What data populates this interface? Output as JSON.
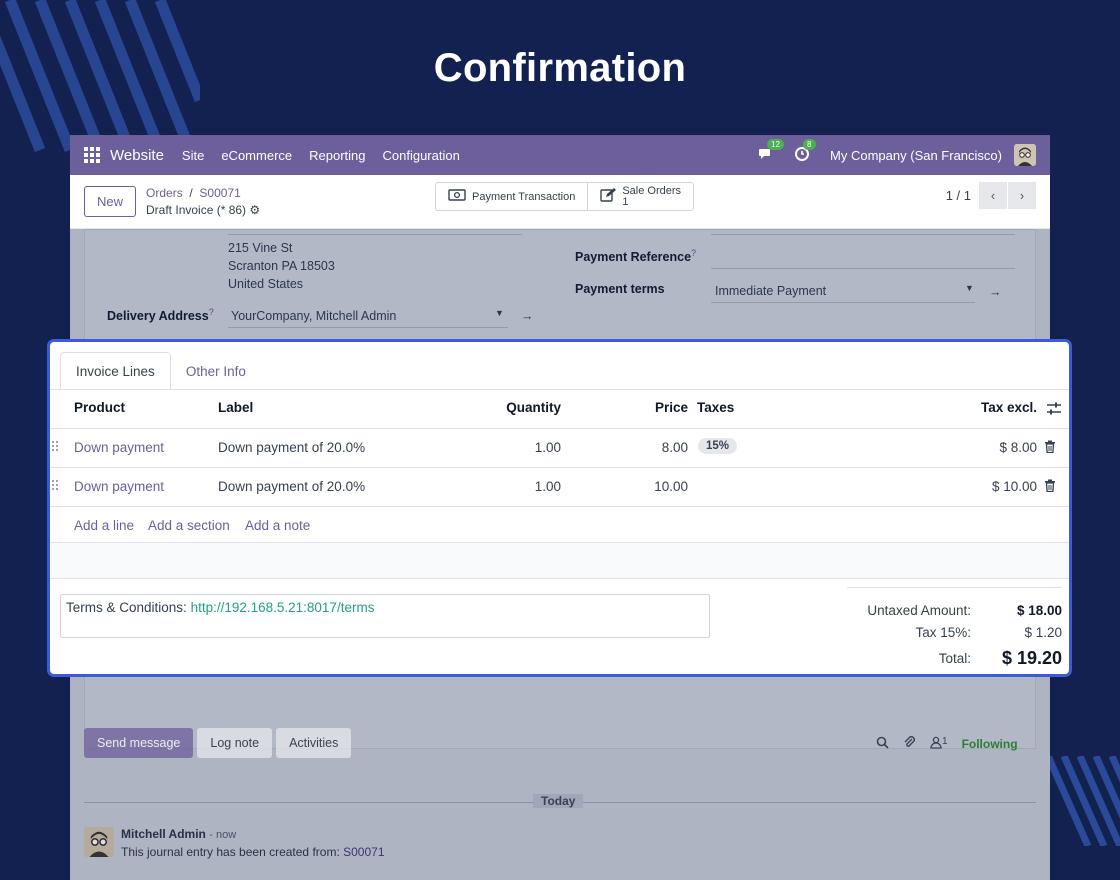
{
  "heading": "Confirmation",
  "navbar": {
    "brand": "Website",
    "menus": [
      "Site",
      "eCommerce",
      "Reporting",
      "Configuration"
    ],
    "messages_count": "12",
    "activities_count": "8",
    "company": "My Company (San Francisco)"
  },
  "control_panel": {
    "new_label": "New",
    "breadcrumb": [
      "Orders",
      "S00071"
    ],
    "record_title": "Draft Invoice (* 86)",
    "smart_buttons": {
      "payment_transaction": "Payment Transaction",
      "sale_orders_label": "Sale Orders",
      "sale_orders_count": "1"
    },
    "pager": "1 / 1"
  },
  "form": {
    "address_lines": [
      "215 Vine St",
      "Scranton PA 18503",
      "United States"
    ],
    "delivery_address_label": "Delivery Address",
    "delivery_address_value": "YourCompany, Mitchell Admin",
    "payment_reference_label": "Payment Reference",
    "payment_terms_label": "Payment terms",
    "payment_terms_value": "Immediate Payment",
    "help_mark": "?"
  },
  "invoice": {
    "tabs": [
      "Invoice Lines",
      "Other Info"
    ],
    "columns": {
      "product": "Product",
      "label": "Label",
      "quantity": "Quantity",
      "price": "Price",
      "taxes": "Taxes",
      "tax_excl": "Tax excl."
    },
    "lines": [
      {
        "product": "Down payment",
        "label": "Down payment of 20.0%",
        "quantity": "1.00",
        "price": "8.00",
        "tax": "15%",
        "subtotal": "$ 8.00"
      },
      {
        "product": "Down payment",
        "label": "Down payment of 20.0%",
        "quantity": "1.00",
        "price": "10.00",
        "tax": "",
        "subtotal": "$ 10.00"
      }
    ],
    "add_links": [
      "Add a line",
      "Add a section",
      "Add a note"
    ],
    "terms_label": "Terms & Conditions:",
    "terms_url": "http://192.168.5.21:8017/terms",
    "totals": {
      "untaxed_label": "Untaxed Amount:",
      "untaxed_value": "$ 18.00",
      "tax_label": "Tax 15%:",
      "tax_value": "$ 1.20",
      "total_label": "Total:",
      "total_value": "$ 19.20"
    }
  },
  "chatter": {
    "send_message": "Send message",
    "log_note": "Log note",
    "activities": "Activities",
    "followers_count": "1",
    "following": "Following",
    "date_separator": "Today",
    "author": "Mitchell Admin",
    "time": "- now",
    "message_prefix": "This journal entry has been created from:",
    "message_link": "S00071"
  },
  "colors": {
    "background": "#12214f",
    "brand": "#6d5f9c",
    "highlight_border": "#3b5bdb",
    "link_green": "#22a085"
  }
}
